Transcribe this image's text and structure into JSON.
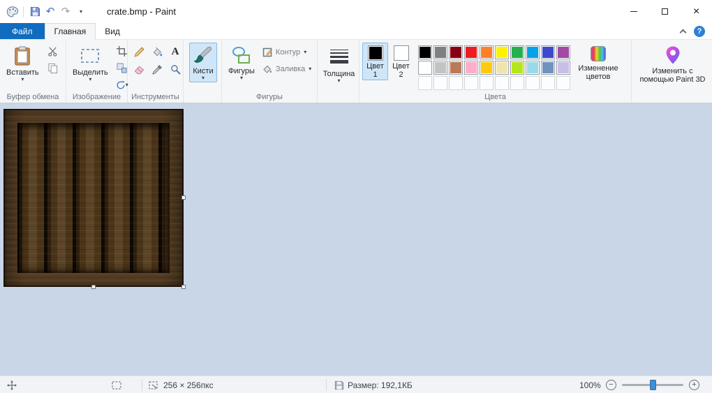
{
  "window": {
    "title": "crate.bmp - Paint"
  },
  "icons": {
    "dropdown": "▾",
    "undo": "↶",
    "redo": "↷",
    "close": "×",
    "help": "?",
    "zoom_out": "−",
    "zoom_in": "+",
    "text_tool": "A"
  },
  "tabs": {
    "file": "Файл",
    "home": "Главная",
    "view": "Вид"
  },
  "ribbon": {
    "paste_label": "Вставить",
    "clipboard_group_label": "Буфер обмена",
    "select_label": "Выделить",
    "image_group_label": "Изображение",
    "tools_group_label": "Инструменты",
    "brushes_label": "Кисти",
    "shapes_button_label": "Фигуры",
    "outline_label": "Контур",
    "fill_label": "Заливка",
    "shapes_group_label": "Фигуры",
    "size_label": "Толщина",
    "color1_label": "Цвет 1",
    "color2_label": "Цвет 2",
    "edit_colors_label": "Изменение цветов",
    "colors_group_label": "Цвета",
    "paint3d_label": "Изменить с помощью Paint 3D"
  },
  "colors": {
    "color1": "#000000",
    "color2": "#FFFFFF",
    "selection_highlight": "#CFE6F8",
    "file_tab_blue": "#0F6CBE",
    "canvas_background": "#C9D6E7",
    "palette_rows": [
      [
        "#000000",
        "#7F7F7F",
        "#880015",
        "#ED1C24",
        "#FF7F27",
        "#FFF200",
        "#22B14C",
        "#00A2E8",
        "#3F48CC",
        "#A349A4"
      ],
      [
        "#FFFFFF",
        "#C3C3C3",
        "#B97A57",
        "#FFAEC9",
        "#FFC90E",
        "#EFE4B0",
        "#B5E61D",
        "#99D9EA",
        "#7092BE",
        "#C8BFE7"
      ],
      [
        null,
        null,
        null,
        null,
        null,
        null,
        null,
        null,
        null,
        null
      ]
    ]
  },
  "statusbar": {
    "dimensions": "256 × 256пкс",
    "file_size": "Размер: 192,1КБ",
    "zoom_level": "100%"
  }
}
